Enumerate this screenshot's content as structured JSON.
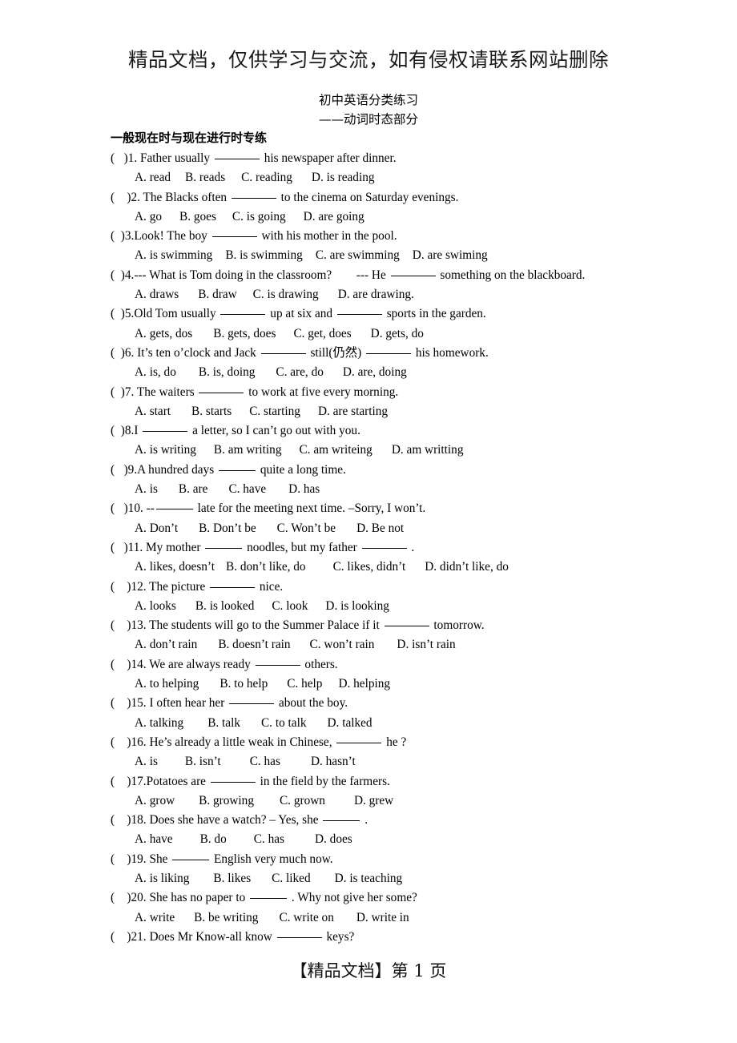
{
  "notice": "精品文档，仅供学习与交流，如有侵权请联系网站删除",
  "title": "初中英语分类练习",
  "subtitle": "——动词时态部分",
  "section_heading": "一般现在时与现在进行时专练",
  "footer": "【精品文档】第 1 页",
  "questions": [
    {
      "bracket": "(   )",
      "stem_parts": [
        "1. Father usually ",
        "BLANK_LG",
        " his newspaper after dinner."
      ],
      "options": [
        "A. read",
        "B. reads",
        "C. reading",
        "D. is reading"
      ]
    },
    {
      "bracket": "(    )",
      "stem_parts": [
        "2. The Blacks often ",
        "BLANK_LG",
        " to the cinema on Saturday evenings."
      ],
      "options": [
        "A. go",
        "B. goes",
        "C. is going",
        "D. are going"
      ]
    },
    {
      "bracket": "(  )",
      "stem_parts": [
        "3.Look! The boy ",
        "BLANK_LG",
        " with his mother in the pool."
      ],
      "options": [
        "A. is swimming",
        "B. is swimming",
        "C. are swimming",
        "D. are swiming"
      ]
    },
    {
      "bracket": "(  )",
      "stem_parts": [
        "4.--- What is Tom doing in the classroom?        --- He ",
        "BLANK_LG",
        " something on the blackboard."
      ],
      "options": [
        "A. draws",
        "B. draw",
        "C. is drawing",
        "D. are drawing."
      ]
    },
    {
      "bracket": "(  )",
      "stem_parts": [
        "5.Old Tom usually ",
        "BLANK_LG",
        " up at six and ",
        "BLANK_LG",
        " sports in the garden."
      ],
      "options": [
        "A. gets, dos",
        "B. gets, does",
        "C. get, does",
        "D. gets, do"
      ]
    },
    {
      "bracket": "(  )",
      "stem_parts": [
        "6. It’s ten o’clock and Jack ",
        "BLANK_LG",
        " still(仍然) ",
        "BLANK_LG",
        " his homework."
      ],
      "options": [
        "A. is, do",
        "B. is, doing",
        "C. are, do",
        "D. are, doing"
      ]
    },
    {
      "bracket": "(  )",
      "stem_parts": [
        "7. The waiters ",
        "BLANK_LG",
        " to work at five every morning."
      ],
      "options": [
        "A. start",
        "B. starts",
        "C. starting",
        "D. are starting"
      ]
    },
    {
      "bracket": "(  )",
      "stem_parts": [
        "8.I ",
        "BLANK_LG",
        " a letter, so I can’t go out with you."
      ],
      "options": [
        "A. is writing",
        "B. am writing",
        "C. am writeing",
        "D. am writting"
      ]
    },
    {
      "bracket": "(   )",
      "stem_parts": [
        "9.A hundred days ",
        "BLANK_MD",
        " quite a long time."
      ],
      "options": [
        "A. is",
        "B. are",
        "C. have",
        "D. has"
      ]
    },
    {
      "bracket": "(   )",
      "stem_parts": [
        "10. --",
        "BLANK_MD",
        " late for the meeting next time. –Sorry, I won’t."
      ],
      "options": [
        "A. Don’t",
        "B. Don’t be",
        "C. Won’t be",
        "D. Be not"
      ]
    },
    {
      "bracket": "(   )",
      "stem_parts": [
        "11. My mother ",
        "BLANK_MD",
        " noodles, but my father ",
        "BLANK_LG",
        " ."
      ],
      "options": [
        "A. likes, doesn’t",
        "B. don’t like, do",
        "C. likes, didn’t",
        "D. didn’t like, do"
      ]
    },
    {
      "bracket": "(    )",
      "stem_parts": [
        "12. The picture ",
        "BLANK_LG",
        " nice."
      ],
      "options": [
        "A. looks",
        "B. is looked",
        "C. look",
        "D. is looking"
      ]
    },
    {
      "bracket": "(    )",
      "stem_parts": [
        "13. The students will go to the Summer Palace if it ",
        "BLANK_LG",
        " tomorrow."
      ],
      "options": [
        "A. don’t rain",
        "B. doesn’t rain",
        "C. won’t rain",
        "D. isn’t rain"
      ]
    },
    {
      "bracket": "(    )",
      "stem_parts": [
        "14. We are always ready ",
        "BLANK_LG",
        " others."
      ],
      "options": [
        "A. to helping",
        "B. to help",
        "C. help",
        "D. helping"
      ]
    },
    {
      "bracket": "(    )",
      "stem_parts": [
        "15. I often hear her ",
        "BLANK_LG",
        " about the boy."
      ],
      "options": [
        "A. talking",
        "B. talk",
        "C. to talk",
        "D. talked"
      ]
    },
    {
      "bracket": "(    )",
      "stem_parts": [
        "16. He’s already a little weak in Chinese, ",
        "BLANK_LG",
        " he ?"
      ],
      "options": [
        "A. is",
        "B. isn’t",
        "C. has",
        "D. hasn’t"
      ]
    },
    {
      "bracket": "(    )",
      "stem_parts": [
        "17.Potatoes are ",
        "BLANK_LG",
        " in the field by the farmers."
      ],
      "options": [
        "A. grow",
        "B. growing",
        "C. grown",
        "D. grew"
      ]
    },
    {
      "bracket": "(    )",
      "stem_parts": [
        "18. Does she have a watch? – Yes, she ",
        "BLANK_MD",
        " ."
      ],
      "options": [
        "A. have",
        "B. do",
        "C. has",
        "D. does"
      ]
    },
    {
      "bracket": "(    )",
      "stem_parts": [
        "19. She ",
        "BLANK_MD",
        " English very much now."
      ],
      "options": [
        "A. is liking",
        "B. likes",
        "C. liked",
        "D. is teaching"
      ]
    },
    {
      "bracket": "(    )",
      "stem_parts": [
        "20. She has no paper to ",
        "BLANK_MD",
        " . Why not give her some?"
      ],
      "options": [
        "A. write",
        "B. be writing",
        "C. write on",
        "D. write in"
      ]
    },
    {
      "bracket": "(    )",
      "stem_parts": [
        "21. Does Mr Know-all know ",
        "BLANK_LG",
        " keys?"
      ],
      "options": []
    }
  ],
  "option_gaps": {
    "0": [
      0,
      18,
      20,
      24
    ],
    "1": [
      0,
      22,
      20,
      22
    ],
    "2": [
      0,
      16,
      16,
      16
    ],
    "3": [
      0,
      24,
      20,
      24
    ],
    "4": [
      0,
      26,
      22,
      24
    ],
    "5": [
      0,
      28,
      26,
      24
    ],
    "6": [
      0,
      26,
      22,
      22
    ],
    "7": [
      0,
      22,
      22,
      24
    ],
    "8": [
      0,
      26,
      26,
      28
    ],
    "9": [
      0,
      26,
      26,
      26
    ],
    "10": [
      0,
      14,
      34,
      24
    ],
    "11": [
      0,
      24,
      22,
      22
    ],
    "12": [
      0,
      26,
      24,
      28
    ],
    "13": [
      0,
      26,
      24,
      20
    ],
    "14": [
      0,
      30,
      26,
      26
    ],
    "15": [
      0,
      34,
      36,
      38
    ],
    "16": [
      0,
      30,
      32,
      36
    ],
    "17": [
      0,
      34,
      34,
      38
    ],
    "18": [
      0,
      30,
      26,
      30
    ],
    "19": [
      0,
      24,
      26,
      28
    ],
    "20": []
  }
}
